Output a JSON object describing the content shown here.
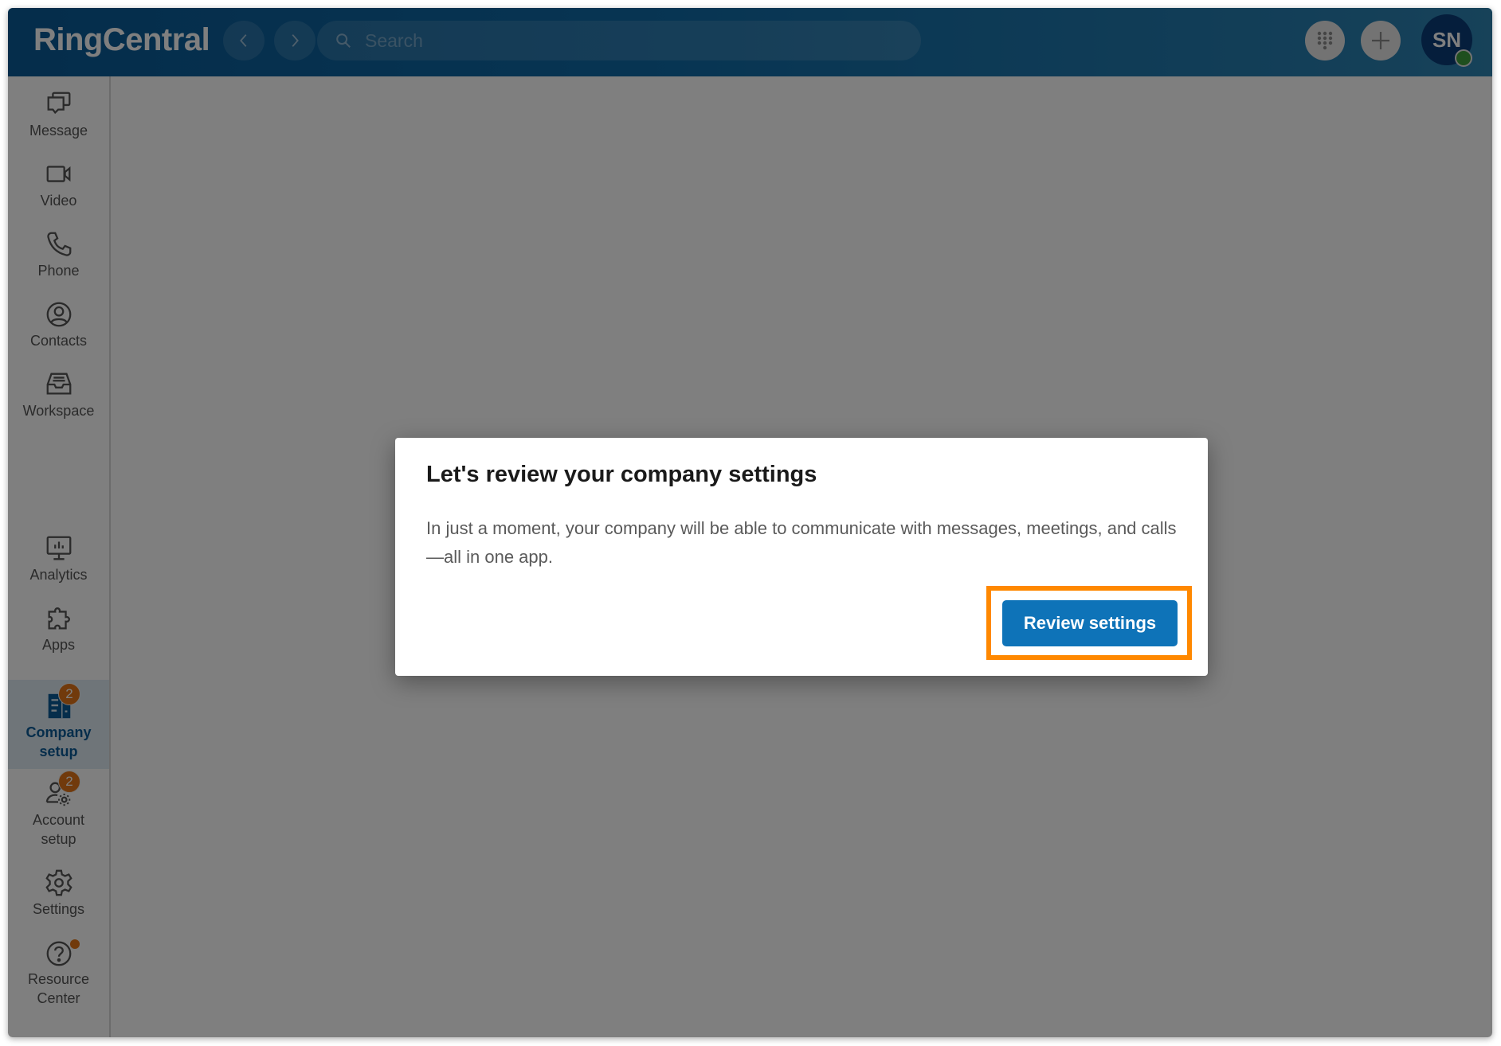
{
  "app": {
    "logo": "RingCentral",
    "accent_color": "#0e73b8",
    "highlight_color": "#ff8800"
  },
  "header": {
    "back_icon": "chevron-left-icon",
    "forward_icon": "chevron-right-icon",
    "search": {
      "placeholder": "Search",
      "value": "",
      "icon": "search-icon"
    },
    "dialpad_icon": "dialpad-icon",
    "add_icon": "plus-icon",
    "avatar_initials": "SN",
    "presence": "online"
  },
  "sidebar": {
    "items": [
      {
        "label": "Message",
        "icon": "message-icon"
      },
      {
        "label": "Video",
        "icon": "video-icon"
      },
      {
        "label": "Phone",
        "icon": "phone-icon"
      },
      {
        "label": "Contacts",
        "icon": "contacts-icon"
      },
      {
        "label": "Workspace",
        "icon": "workspace-icon"
      },
      {
        "label": "Analytics",
        "icon": "analytics-icon"
      },
      {
        "label": "Apps",
        "icon": "apps-icon"
      },
      {
        "label_line1": "Company",
        "label_line2": "setup",
        "icon": "company-setup-icon",
        "badge": "2",
        "active": true
      },
      {
        "label_line1": "Account",
        "label_line2": "setup",
        "icon": "account-setup-icon",
        "badge": "2"
      },
      {
        "label": "Settings",
        "icon": "settings-icon"
      },
      {
        "label_line1": "Resource",
        "label_line2": "Center",
        "icon": "help-icon",
        "notification_dot": true
      }
    ]
  },
  "dialog": {
    "title": "Let's review your company settings",
    "body": "In just a moment, your company will be able to communicate with messages, meetings, and calls—all in one app.",
    "primary_button": "Review settings"
  }
}
